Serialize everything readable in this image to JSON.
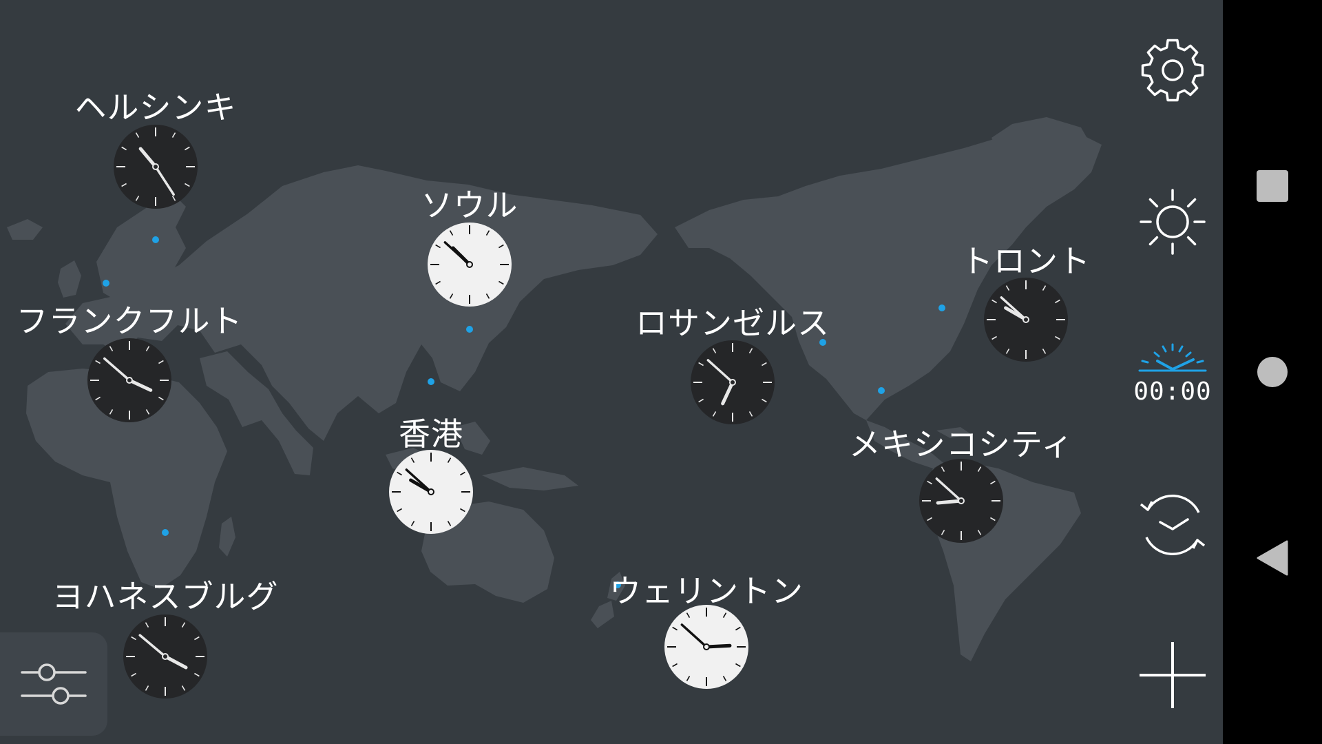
{
  "colors": {
    "background": "#353b40",
    "land": "#4a5056",
    "accent": "#1fa2e6",
    "clock_dark": "#252628",
    "clock_light": "#f1f1f1",
    "navbar": "#000000"
  },
  "cities": [
    {
      "name": "ヘルシンキ",
      "theme": "dark",
      "hour_angle": 320,
      "minute_angle": 147,
      "second_angle": null
    },
    {
      "name": "フランクフルト",
      "theme": "dark",
      "hour_angle": 115,
      "minute_angle": 311,
      "second_angle": null
    },
    {
      "name": "ヨハネスブルグ",
      "theme": "dark",
      "hour_angle": 118,
      "minute_angle": 310,
      "second_angle": null
    },
    {
      "name": "ソウル",
      "theme": "light",
      "hour_angle": 315,
      "minute_angle": 312,
      "second_angle": null
    },
    {
      "name": "香港",
      "theme": "light",
      "hour_angle": 300,
      "minute_angle": 312,
      "second_angle": null
    },
    {
      "name": "ロサンゼルス",
      "theme": "dark",
      "hour_angle": 205,
      "minute_angle": 312,
      "second_angle": null
    },
    {
      "name": "トロント",
      "theme": "dark",
      "hour_angle": 300,
      "minute_angle": 312,
      "second_angle": null
    },
    {
      "name": "メキシコシティ",
      "theme": "dark",
      "hour_angle": 265,
      "minute_angle": 312,
      "second_angle": null
    },
    {
      "name": "ウェリントン",
      "theme": "light",
      "hour_angle": 87,
      "minute_angle": 312,
      "second_angle": null
    }
  ],
  "toolbar": {
    "settings_icon": "gear-icon",
    "brightness_icon": "sun-icon",
    "alarm_icon": "alarm-clock-icon",
    "alarm_time": "00:00",
    "sync_icon": "clock-sync-icon",
    "add_icon": "plus-icon"
  },
  "filter_icon": "sliders-icon",
  "navbar": {
    "recents_icon": "square-icon",
    "home_icon": "circle-icon",
    "back_icon": "triangle-back-icon"
  }
}
